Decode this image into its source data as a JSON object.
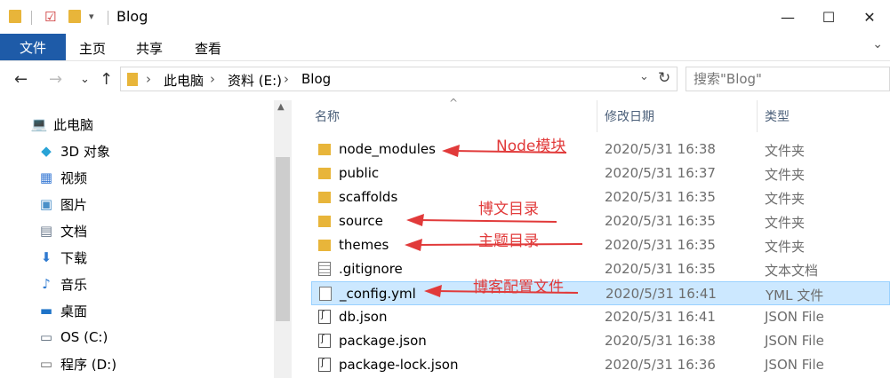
{
  "window": {
    "title": "Blog",
    "controls": {
      "minimize": "—",
      "maximize": "☐",
      "close": "✕"
    },
    "quick_access_drop": "▾"
  },
  "ribbon": {
    "tabs": [
      "文件",
      "主页",
      "共享",
      "查看"
    ],
    "expand": "⌄"
  },
  "nav": {
    "back": "←",
    "forward": "→",
    "recent": "⌄",
    "up": "↑",
    "breadcrumb": [
      "此电脑",
      "资料 (E:)",
      "Blog"
    ],
    "separator": "›",
    "dropdown": "⌄",
    "refresh": "↻",
    "search_placeholder": "搜索\"Blog\""
  },
  "sidebar": {
    "items": [
      {
        "label": "此电脑",
        "icon": "computer-icon",
        "glyph": "💻"
      },
      {
        "label": "3D 对象",
        "icon": "3d-objects-icon",
        "glyph": "◆"
      },
      {
        "label": "视频",
        "icon": "videos-icon",
        "glyph": "▦"
      },
      {
        "label": "图片",
        "icon": "pictures-icon",
        "glyph": "▣"
      },
      {
        "label": "文档",
        "icon": "documents-icon",
        "glyph": "▤"
      },
      {
        "label": "下载",
        "icon": "downloads-icon",
        "glyph": "⬇"
      },
      {
        "label": "音乐",
        "icon": "music-icon",
        "glyph": "♪"
      },
      {
        "label": "桌面",
        "icon": "desktop-icon",
        "glyph": "▬"
      },
      {
        "label": "OS (C:)",
        "icon": "drive-icon",
        "glyph": "▭"
      },
      {
        "label": "程序 (D:)",
        "icon": "drive-icon",
        "glyph": "▭"
      }
    ]
  },
  "file_list": {
    "columns": {
      "name": "名称",
      "modified": "修改日期",
      "type": "类型"
    },
    "sort_indicator": "^",
    "rows": [
      {
        "name": "node_modules",
        "modified": "2020/5/31 16:38",
        "type": "文件夹",
        "kind": "folder"
      },
      {
        "name": "public",
        "modified": "2020/5/31 16:37",
        "type": "文件夹",
        "kind": "folder"
      },
      {
        "name": "scaffolds",
        "modified": "2020/5/31 16:35",
        "type": "文件夹",
        "kind": "folder"
      },
      {
        "name": "source",
        "modified": "2020/5/31 16:35",
        "type": "文件夹",
        "kind": "folder"
      },
      {
        "name": "themes",
        "modified": "2020/5/31 16:35",
        "type": "文件夹",
        "kind": "folder"
      },
      {
        "name": ".gitignore",
        "modified": "2020/5/31 16:35",
        "type": "文本文档",
        "kind": "text"
      },
      {
        "name": "_config.yml",
        "modified": "2020/5/31 16:41",
        "type": "YML 文件",
        "kind": "file",
        "selected": true
      },
      {
        "name": "db.json",
        "modified": "2020/5/31 16:41",
        "type": "JSON File",
        "kind": "json"
      },
      {
        "name": "package.json",
        "modified": "2020/5/31 16:38",
        "type": "JSON File",
        "kind": "json"
      },
      {
        "name": "package-lock.json",
        "modified": "2020/5/31 16:36",
        "type": "JSON File",
        "kind": "json"
      }
    ]
  },
  "annotations": {
    "node": "Node模块",
    "source": "博文目录",
    "themes": "主题目录",
    "config": "博客配置文件"
  },
  "colors": {
    "accent": "#1e5ba8",
    "annotation": "#e13a3a",
    "folder": "#e8b53a",
    "selection": "#cce8ff"
  }
}
